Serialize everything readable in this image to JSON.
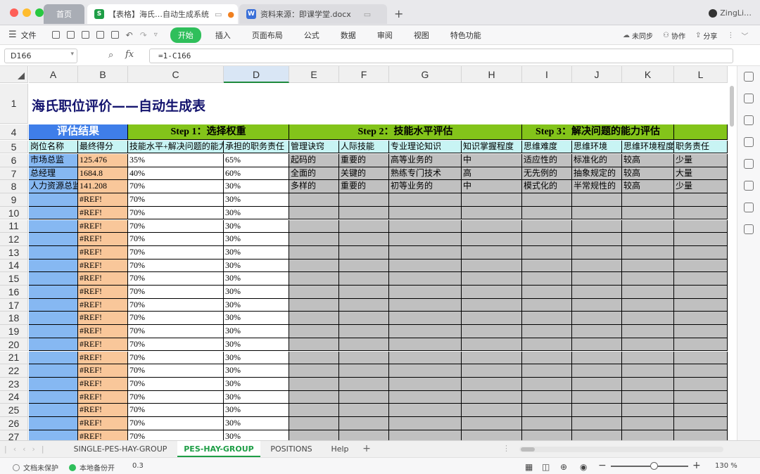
{
  "window": {
    "home_tab": "首页",
    "active_tab": "【表格】海氏…自动生成系统",
    "active_tab_icon": "S",
    "second_tab": "资料来源：即课学堂.docx",
    "second_tab_icon": "W",
    "user": "ZingLi…"
  },
  "menu": {
    "file": "文件",
    "items": [
      "开始",
      "插入",
      "页面布局",
      "公式",
      "数据",
      "审阅",
      "视图",
      "特色功能"
    ],
    "sync": "未同步",
    "collab": "协作",
    "share": "分享"
  },
  "formula_bar": {
    "name_box": "D166",
    "fx": "fx",
    "formula": "=1-C166"
  },
  "columns": [
    "A",
    "B",
    "C",
    "D",
    "E",
    "F",
    "G",
    "H",
    "I",
    "J",
    "K",
    "L"
  ],
  "row_numbers": [
    "1",
    "4",
    "5",
    "6",
    "7",
    "8",
    "9",
    "10",
    "11",
    "12",
    "13",
    "14",
    "15",
    "16",
    "17",
    "18",
    "19",
    "20",
    "21",
    "22",
    "23",
    "24",
    "25",
    "26",
    "27"
  ],
  "sheet": {
    "title": "海氏职位评价——自动生成表",
    "sections": [
      "评估结果",
      "Step 1：选择权重",
      "Step 2：技能水平评估",
      "Step 3：解决问题的能力评估"
    ],
    "headers": [
      "岗位名称",
      "最终得分",
      "技能水平+解决问题的能力",
      "承担的职务责任",
      "管理诀窍",
      "人际技能",
      "专业理论知识",
      "知识掌握程度",
      "思维难度",
      "思维环境",
      "思维环境程度",
      "职务责任"
    ],
    "rows": [
      [
        "市场总监",
        "125.476",
        "35%",
        "65%",
        "起码的",
        "重要的",
        "高等业务的",
        "中",
        "适应性的",
        "标准化的",
        "较高",
        "少量"
      ],
      [
        "总经理",
        "1684.8",
        "40%",
        "60%",
        "全面的",
        "关键的",
        "熟练专门技术",
        "高",
        "无先例的",
        "抽象规定的",
        "较高",
        "大量"
      ],
      [
        "人力资源总监",
        "141.208",
        "70%",
        "30%",
        "多样的",
        "重要的",
        "初等业务的",
        "中",
        "模式化的",
        "半常规性的",
        "较高",
        "少量"
      ]
    ],
    "default_row": {
      "A": "",
      "B": "#REF!",
      "C": "70%",
      "D": "30%"
    }
  },
  "sheet_tabs": [
    "SINGLE-PES-HAY-GROUP",
    "PES-HAY-GROUP",
    "POSITIONS",
    "Help"
  ],
  "active_sheet": "PES-HAY-GROUP",
  "status": {
    "protect": "文档未保护",
    "backup": "本地备份开",
    "value": "0.3",
    "zoom": "130 %",
    "zoom_level": 0.55
  },
  "colors": {
    "section_blue": "#3f7ee9",
    "section_green": "#83c41a",
    "cell_blue": "#86b8f2",
    "cell_orange": "#f9c79a",
    "cell_gray": "#c0c0c0",
    "header_cyan": "#c8f4f4",
    "title": "#14146e",
    "active_green": "#1e9e46"
  }
}
